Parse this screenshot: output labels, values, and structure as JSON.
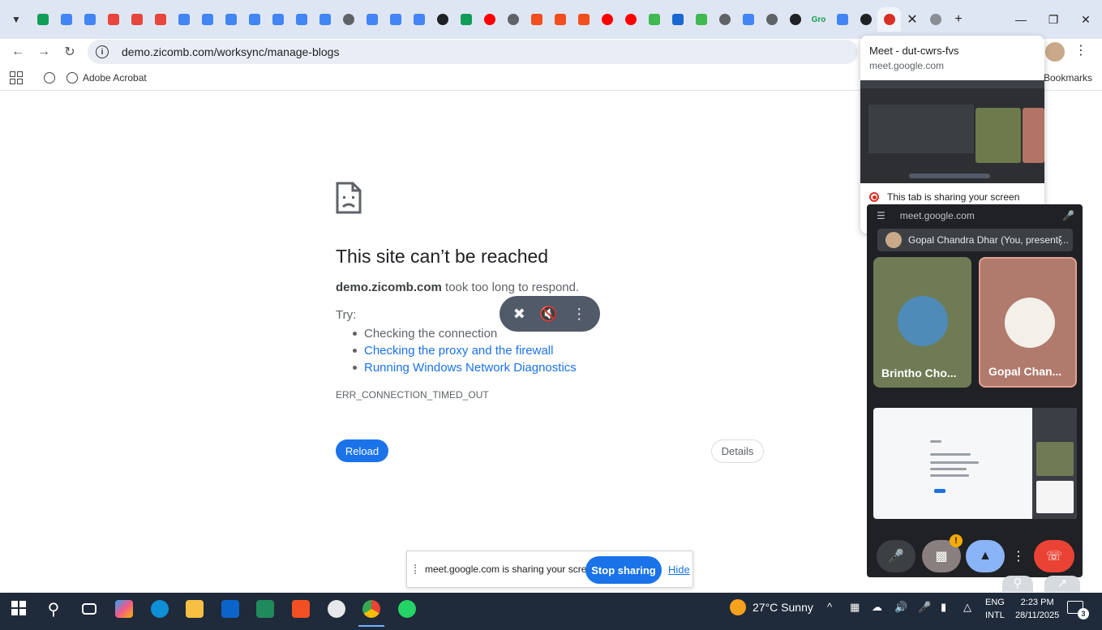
{
  "browser": {
    "tabs": {
      "favicons": [
        {
          "icon": "drive-icon",
          "color": "#0f9d58"
        },
        {
          "icon": "docs-icon",
          "color": "#4285f4"
        },
        {
          "icon": "docs-icon",
          "color": "#4285f4"
        },
        {
          "icon": "check-icon",
          "color": "#e8453c"
        },
        {
          "icon": "check-icon",
          "color": "#e8453c"
        },
        {
          "icon": "bolt-icon",
          "color": "#e8453c"
        },
        {
          "icon": "docs-icon",
          "color": "#4285f4"
        },
        {
          "icon": "docs-icon",
          "color": "#4285f4"
        },
        {
          "icon": "docs-icon",
          "color": "#4285f4"
        },
        {
          "icon": "docs-icon",
          "color": "#4285f4"
        },
        {
          "icon": "docs-icon",
          "color": "#4285f4"
        },
        {
          "icon": "docs-icon",
          "color": "#4285f4"
        },
        {
          "icon": "hex-icon",
          "color": "#4285f4"
        },
        {
          "icon": "globe-icon",
          "color": "#5f6368"
        },
        {
          "icon": "translate-icon",
          "color": "#4285f4"
        },
        {
          "icon": "translate-icon",
          "color": "#4285f4"
        },
        {
          "icon": "translate-icon",
          "color": "#4285f4"
        },
        {
          "icon": "openai-icon",
          "color": "#202124"
        },
        {
          "icon": "sheets-icon",
          "color": "#0f9d58"
        },
        {
          "icon": "youtube-icon",
          "color": "#ff0000"
        },
        {
          "icon": "globe-icon",
          "color": "#5f6368"
        },
        {
          "icon": "figma-icon",
          "color": "#f24e1e"
        },
        {
          "icon": "figma-icon",
          "color": "#f24e1e"
        },
        {
          "icon": "figma-icon",
          "color": "#f24e1e"
        },
        {
          "icon": "youtube-icon",
          "color": "#ff0000"
        },
        {
          "icon": "youtube-icon",
          "color": "#ff0000"
        },
        {
          "icon": "zapier-icon",
          "color": "#3fb950"
        },
        {
          "icon": "cross-icon",
          "color": "#1967d2"
        },
        {
          "icon": "zapier-icon",
          "color": "#3fb950"
        },
        {
          "icon": "globe-icon",
          "color": "#5f6368"
        },
        {
          "icon": "docs-icon",
          "color": "#4285f4"
        },
        {
          "icon": "globe-icon",
          "color": "#5f6368"
        },
        {
          "icon": "openai-icon",
          "color": "#202124"
        },
        {
          "icon": "gro-icon",
          "color": "#15a24a"
        },
        {
          "icon": "docs-icon",
          "color": "#4285f4"
        },
        {
          "icon": "openai-icon",
          "color": "#202124"
        },
        {
          "icon": "meet-recording-icon",
          "color": "#d93025"
        }
      ],
      "gro_label": "Gro"
    },
    "url": "demo.zicomb.com/worksync/manage-blogs",
    "bookmarks": {
      "acrobat": "Adobe Acrobat",
      "all": "Bookmarks"
    }
  },
  "error_page": {
    "title": "This site can’t be reached",
    "host": "demo.zicomb.com",
    "desc_tail": " took too long to respond.",
    "try_label": "Try:",
    "suggestions": [
      {
        "text": "Checking the connection",
        "link": false
      },
      {
        "text": "Checking the proxy and the firewall",
        "link": true
      },
      {
        "text": "Running Windows Network Diagnostics",
        "link": true
      }
    ],
    "error_code": "ERR_CONNECTION_TIMED_OUT",
    "reload_label": "Reload",
    "details_label": "Details"
  },
  "hover_card": {
    "title": "Meet - dut-cwrs-fvs",
    "domain": "meet.google.com",
    "sharing_text": "This tab is sharing your screen"
  },
  "pip": {
    "domain": "meet.google.com",
    "presenter": "Gopal Chandra Dhar (You, presenti...",
    "participants": [
      {
        "name": "Brintho Cho..."
      },
      {
        "name": "Gopal Chan..."
      }
    ],
    "camera_warning": "!"
  },
  "sharebar": {
    "message": "meet.google.com is sharing your screen.",
    "stop_label": "Stop sharing",
    "hide_label": "Hide"
  },
  "taskbar": {
    "weather": "27°C Sunny",
    "lang_line1": "ENG",
    "lang_line2": "INTL",
    "time": "2:23 PM",
    "date": "28/11/2025",
    "notifications": "3"
  }
}
